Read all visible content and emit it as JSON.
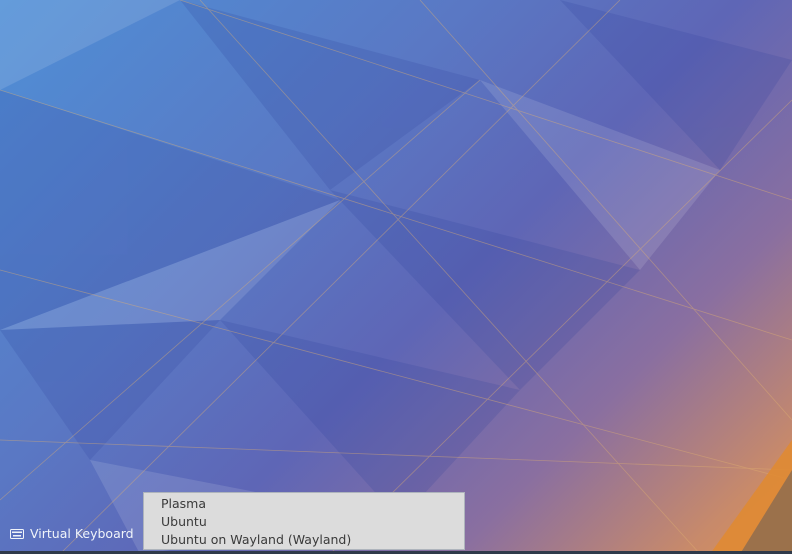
{
  "virtual_keyboard": {
    "label": "Virtual Keyboard",
    "icon": "keyboard-icon"
  },
  "session_menu": {
    "items": [
      "Plasma",
      "Ubuntu",
      "Ubuntu on Wayland (Wayland)"
    ]
  }
}
